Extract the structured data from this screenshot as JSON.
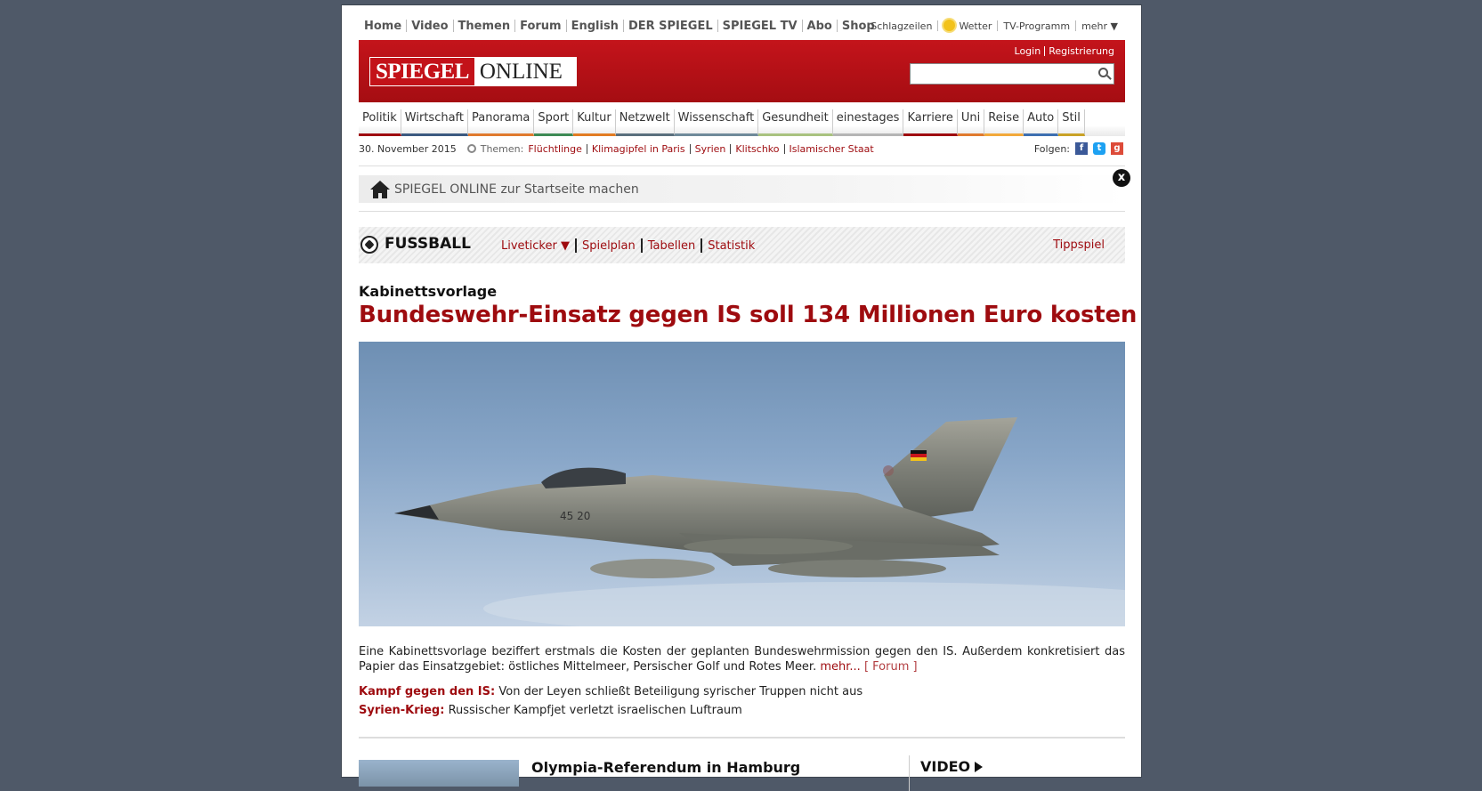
{
  "top_nav": {
    "items": [
      "Home",
      "Video",
      "Themen",
      "Forum",
      "English",
      "DER SPIEGEL",
      "SPIEGEL TV",
      "Abo",
      "Shop"
    ],
    "right": [
      "Schlagzeilen",
      "Wetter",
      "TV-Programm",
      "mehr ▼"
    ]
  },
  "masthead": {
    "logo_left": "SPIEGEL",
    "logo_right": "ONLINE",
    "login": "Login",
    "register": "Registrierung",
    "search_placeholder": ""
  },
  "sections": [
    {
      "label": "Politik",
      "color": "#9e0b0f"
    },
    {
      "label": "Wirtschaft",
      "color": "#3c5a80"
    },
    {
      "label": "Panorama",
      "color": "#e07a2e"
    },
    {
      "label": "Sport",
      "color": "#3e8a55"
    },
    {
      "label": "Kultur",
      "color": "#e27c23"
    },
    {
      "label": "Netzwelt",
      "color": "#5a6f7d"
    },
    {
      "label": "Wissenschaft",
      "color": "#6f8a9a"
    },
    {
      "label": "Gesundheit",
      "color": "#a9c27f"
    },
    {
      "label": "einestages",
      "color": "#b5b5b5"
    },
    {
      "label": "Karriere",
      "color": "#9e0b0f"
    },
    {
      "label": "Uni",
      "color": "#e07a2e"
    },
    {
      "label": "Reise",
      "color": "#f2a93b"
    },
    {
      "label": "Auto",
      "color": "#3e6fb0"
    },
    {
      "label": "Stil",
      "color": "#c9a227"
    }
  ],
  "date_row": {
    "date": "30. November 2015",
    "themes_label": "Themen:",
    "themes": [
      "Flüchtlinge",
      "Klimagipfel in Paris",
      "Syrien",
      "Klitschko",
      "Islamischer Staat"
    ],
    "follow_label": "Folgen:"
  },
  "startbar": {
    "text": "SPIEGEL ONLINE zur Startseite machen",
    "close": "x"
  },
  "fussball": {
    "title": "FUSSBALL",
    "links": [
      "Liveticker ▼",
      "Spielplan",
      "Tabellen",
      "Statistik"
    ],
    "tippspiel": "Tippspiel"
  },
  "article": {
    "kicker": "Kabinettsvorlage",
    "headline": "Bundeswehr-Einsatz gegen IS soll 134 Millionen Euro kosten",
    "image_caption_marking": "45 20",
    "teaser": "Eine Kabinettsvorlage beziffert erstmals die Kosten der geplanten Bundeswehrmission gegen den IS. Außerdem konkretisiert das Papier das Einsatzgebiet: östliches Mittelmeer, Persischer Golf und Rotes Meer.",
    "more": "mehr...",
    "forum": "[ Forum ]",
    "related": [
      {
        "label": "Kampf gegen den IS:",
        "text": "Von der Leyen schließt Beteiligung syrischer Truppen nicht aus"
      },
      {
        "label": "Syrien-Krieg:",
        "text": "Russischer Kampfjet verletzt israelischen Luftraum"
      }
    ]
  },
  "bottom": {
    "olympia_title": "Olympia-Referendum in Hamburg",
    "video_label": "VIDEO"
  }
}
